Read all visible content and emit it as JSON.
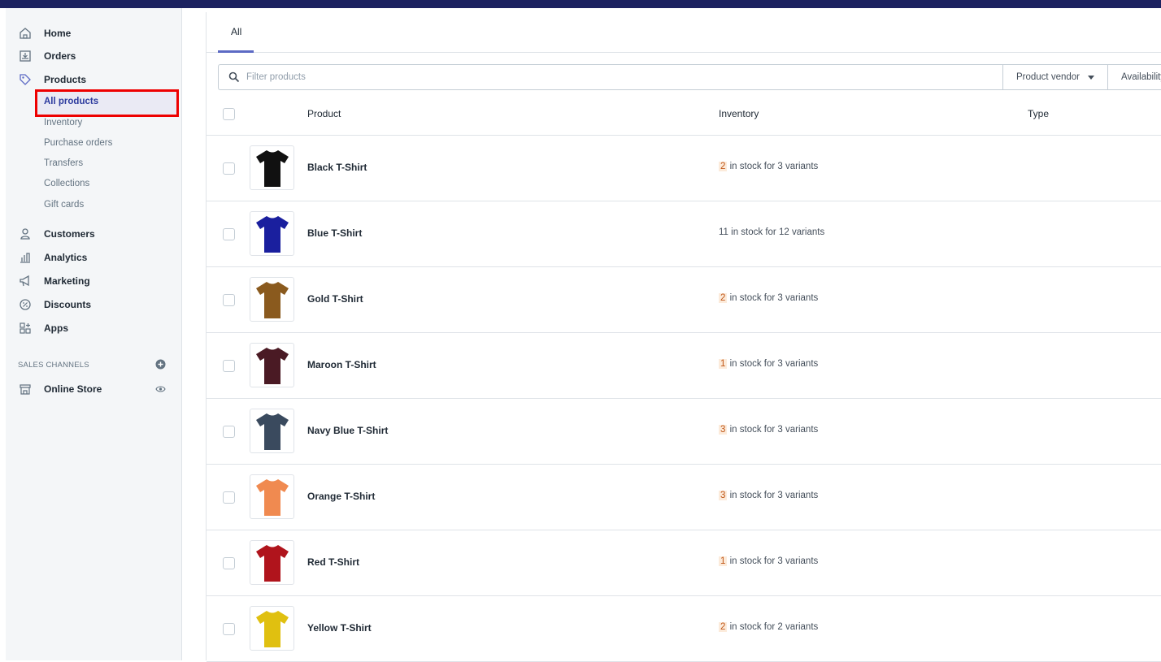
{
  "sidebar": {
    "nav": [
      {
        "label": "Home",
        "icon": "home-icon"
      },
      {
        "label": "Orders",
        "icon": "orders-icon"
      },
      {
        "label": "Products",
        "icon": "tag-icon"
      }
    ],
    "products_sub": {
      "active": "All products",
      "items": [
        "Inventory",
        "Purchase orders",
        "Transfers",
        "Collections",
        "Gift cards"
      ]
    },
    "nav2": [
      {
        "label": "Customers",
        "icon": "person-icon"
      },
      {
        "label": "Analytics",
        "icon": "bar-chart-icon"
      },
      {
        "label": "Marketing",
        "icon": "megaphone-icon"
      },
      {
        "label": "Discounts",
        "icon": "discount-icon"
      },
      {
        "label": "Apps",
        "icon": "apps-icon"
      }
    ],
    "sales_channels_heading": "SALES CHANNELS",
    "online_store": "Online Store"
  },
  "tabs": [
    {
      "label": "All"
    }
  ],
  "filter": {
    "placeholder": "Filter products",
    "vendor_label": "Product vendor",
    "availability_label": "Availability"
  },
  "table": {
    "headers": {
      "product": "Product",
      "inventory": "Inventory",
      "type": "Type"
    },
    "rows": [
      {
        "name": "Black T-Shirt",
        "qty": "2",
        "inventory_suffix": "in stock for 3 variants",
        "low": true,
        "color": "#111111"
      },
      {
        "name": "Blue T-Shirt",
        "qty": "11",
        "inventory_suffix": "in stock for 12 variants",
        "low": false,
        "color": "#1a1f9e"
      },
      {
        "name": "Gold T-Shirt",
        "qty": "2",
        "inventory_suffix": "in stock for 3 variants",
        "low": true,
        "color": "#8a5a1e"
      },
      {
        "name": "Maroon T-Shirt",
        "qty": "1",
        "inventory_suffix": "in stock for 3 variants",
        "low": true,
        "color": "#4a1a24"
      },
      {
        "name": "Navy Blue T-Shirt",
        "qty": "3",
        "inventory_suffix": "in stock for 3 variants",
        "low": true,
        "color": "#3a4a5e"
      },
      {
        "name": "Orange T-Shirt",
        "qty": "3",
        "inventory_suffix": "in stock for 3 variants",
        "low": true,
        "color": "#f08a50"
      },
      {
        "name": "Red T-Shirt",
        "qty": "1",
        "inventory_suffix": "in stock for 3 variants",
        "low": true,
        "color": "#b0141c"
      },
      {
        "name": "Yellow T-Shirt",
        "qty": "2",
        "inventory_suffix": "in stock for 2 variants",
        "low": true,
        "color": "#e0c010"
      }
    ]
  },
  "colors": {
    "topbar": "#1c2260",
    "accent": "#5c6ac4",
    "highlight_box": "#ee0000",
    "low_stock_bg": "#fcebdb"
  }
}
